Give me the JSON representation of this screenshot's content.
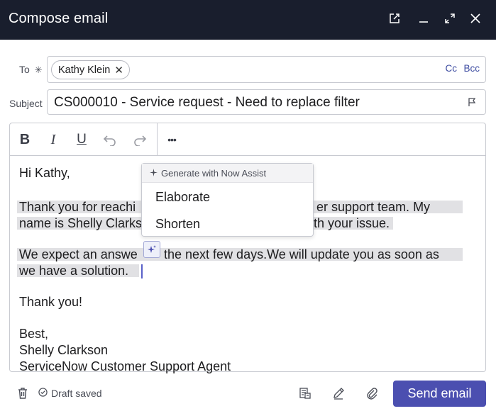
{
  "window": {
    "title": "Compose email",
    "controls": [
      "open-external-icon",
      "minimize-icon",
      "expand-icon",
      "close-icon"
    ]
  },
  "to": {
    "label": "To",
    "required_marker": "✳",
    "recipients": [
      "Kathy Klein"
    ],
    "cc_label": "Cc",
    "bcc_label": "Bcc"
  },
  "subject": {
    "label": "Subject",
    "value": "CS000010 - Service request - Need to replace filter"
  },
  "toolbar": {
    "bold": "B",
    "italic": "I",
    "underline": "U",
    "more": "•••"
  },
  "body": {
    "greeting": "Hi Kathy,",
    "p1_line1_left": "Thank you for reachi",
    "p1_line1_right": "er support team. My",
    "p1_line2_left": "name is Shelly Clarks",
    "p1_line2_right": "ith your issue.",
    "p2_line1_left": "We expect an answe",
    "p2_line1_right": "the next few days.We will update you as soon as",
    "p2_line2": "we have a solution.",
    "thanks": "Thank you!",
    "closing": "Best,",
    "signature_name": "Shelly Clarkson",
    "signature_title": "ServiceNow Customer Support Agent"
  },
  "assist_menu": {
    "header": "Generate with Now Assist",
    "options": [
      "Elaborate",
      "Shorten"
    ]
  },
  "footer": {
    "draft_status": "Draft saved",
    "send_label": "Send email"
  },
  "colors": {
    "titlebar_bg": "#191e2d",
    "accent": "#4b4fb0",
    "selection": "#e1e1e4"
  }
}
